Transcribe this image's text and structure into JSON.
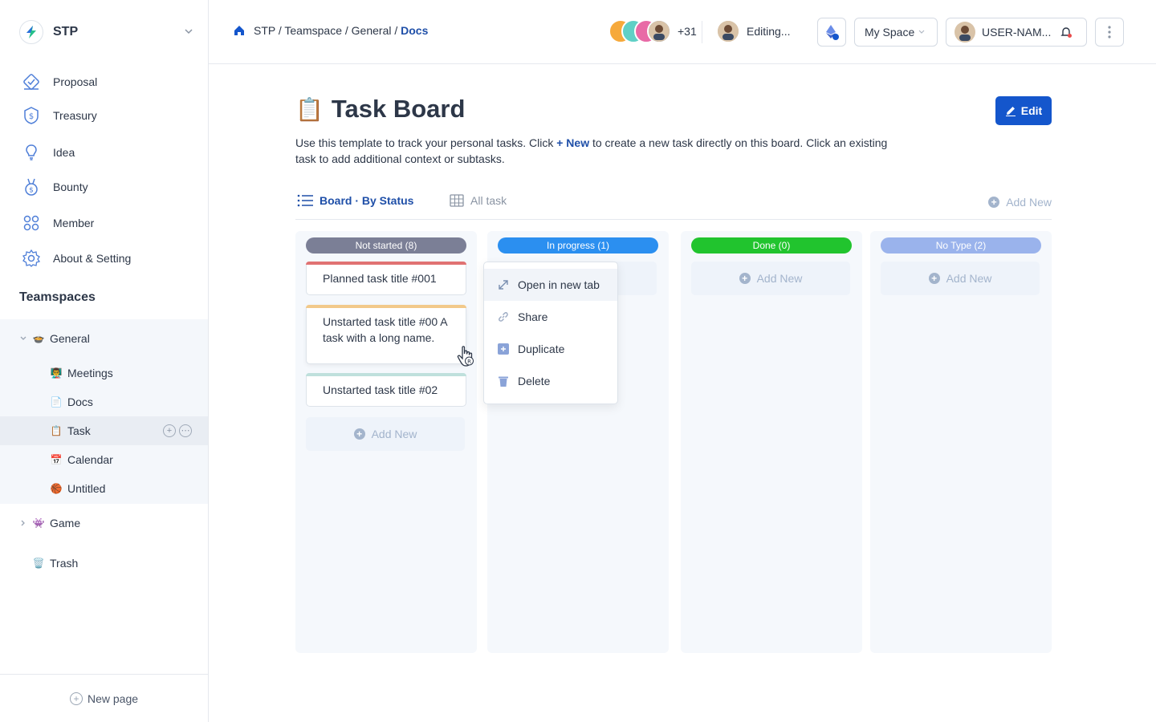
{
  "sidebar": {
    "workspace_name": "STP",
    "nav": [
      {
        "label": "Proposal",
        "icon": "proposal-icon"
      },
      {
        "label": "Treasury",
        "icon": "treasury-icon"
      },
      {
        "label": "Idea",
        "icon": "lightbulb-icon"
      },
      {
        "label": "Bounty",
        "icon": "medal-icon"
      },
      {
        "label": "Member",
        "icon": "members-icon"
      },
      {
        "label": "About & Setting",
        "icon": "gear-icon"
      }
    ],
    "teamspaces_title": "Teamspaces",
    "tree": {
      "general": {
        "emoji": "🍲",
        "label": "General"
      },
      "children": [
        {
          "emoji": "👨‍🏫",
          "label": "Meetings"
        },
        {
          "emoji": "📄",
          "label": "Docs"
        },
        {
          "emoji": "📋",
          "label": "Task"
        },
        {
          "emoji": "📅",
          "label": "Calendar"
        },
        {
          "emoji": "🏀",
          "label": "Untitled"
        }
      ],
      "game": {
        "emoji": "👾",
        "label": "Game"
      },
      "trash": {
        "emoji": "🗑️",
        "label": "Trash"
      }
    },
    "new_page_label": "New page"
  },
  "topbar": {
    "breadcrumb": {
      "path": "STP / Teamspace / General / ",
      "current": "Docs"
    },
    "avatar_count": "+31",
    "editing_label": "Editing...",
    "space_label": "My Space",
    "user_label": "USER-NAM..."
  },
  "page": {
    "emoji": "📋",
    "title": "Task Board",
    "edit_label": "Edit",
    "desc_before": "Use this template to track your personal tasks. Click ",
    "desc_highlight": "+ New",
    "desc_after": " to create a new task directly on this board. Click an existing task to add additional context or subtasks."
  },
  "views": {
    "active": "Board · By Status",
    "inactive": "All task",
    "add_new": "Add New"
  },
  "board": {
    "columns": [
      {
        "label": "Not started (8)",
        "color": "#7b7f96"
      },
      {
        "label": "In progress (1)",
        "color": "#2b8ff0"
      },
      {
        "label": "Done (0)",
        "color": "#21c42e"
      },
      {
        "label": "No Type (2)",
        "color": "#9ab3ec"
      }
    ],
    "cards": [
      {
        "title": "Planned task title #001",
        "bar_color": "#e07272"
      },
      {
        "title": "Unstarted task title #00 A task with a long name.",
        "bar_color": "#f2c98a"
      },
      {
        "title": "Unstarted task title #02",
        "bar_color": "#bfe0dc"
      }
    ],
    "add_new": "Add New"
  },
  "context_menu": {
    "items": [
      {
        "label": "Open in new tab",
        "icon": "open-new-tab-icon"
      },
      {
        "label": "Share",
        "icon": "link-icon"
      },
      {
        "label": "Duplicate",
        "icon": "duplicate-icon"
      },
      {
        "label": "Delete",
        "icon": "trash-icon"
      }
    ]
  }
}
